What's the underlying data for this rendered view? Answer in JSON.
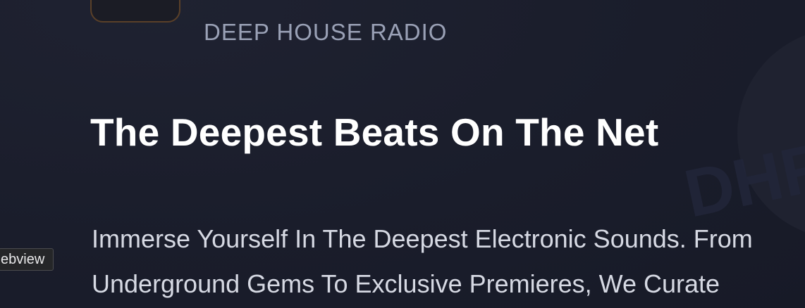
{
  "station": {
    "eyebrow": "DEEP HOUSE RADIO",
    "watermark": "DHR"
  },
  "hero": {
    "headline": "The Deepest Beats On The Net",
    "description": "Immerse Yourself In The Deepest Electronic Sounds. From Underground Gems To Exclusive Premieres, We Curate"
  },
  "tooltip": {
    "text": "ebview"
  },
  "colors": {
    "background": "#1a1d2b",
    "accent": "#e8943a",
    "eyebrow": "#9aa1b6",
    "headline": "#ffffff",
    "body": "#d6d9e3"
  }
}
